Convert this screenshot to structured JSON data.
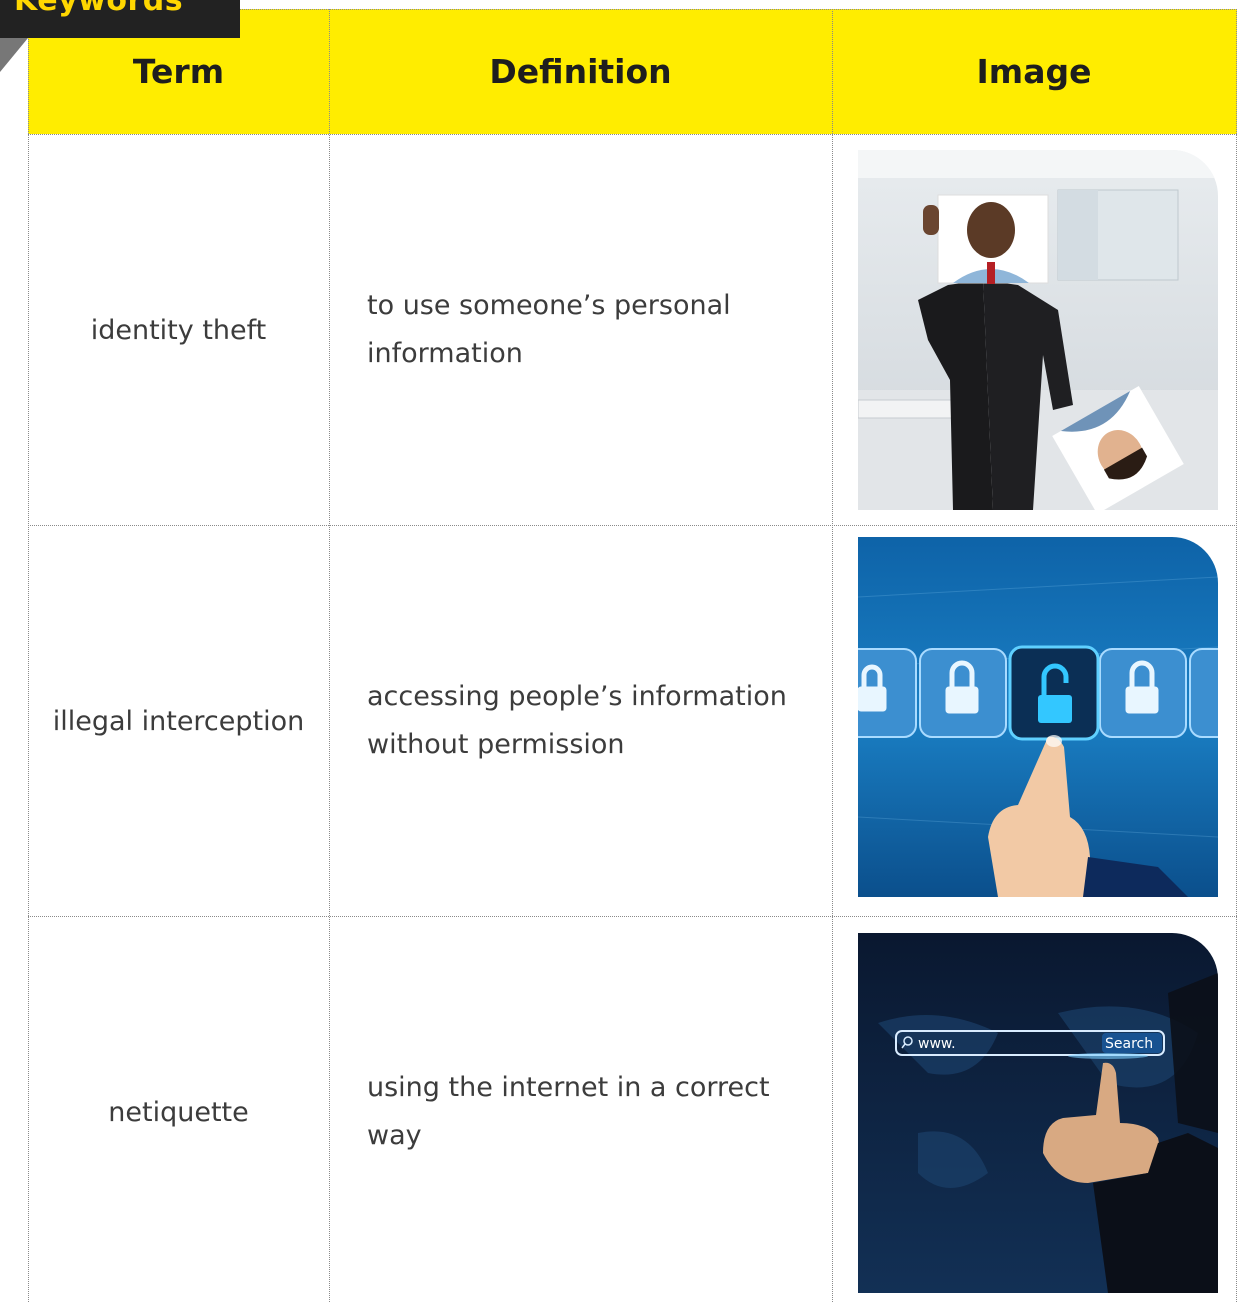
{
  "tab": {
    "label": "Keywords"
  },
  "header": {
    "term": "Term",
    "definition": "Definition",
    "image": "Image"
  },
  "rows": [
    {
      "term": "identity theft",
      "definition": "to use someone’s personal information",
      "image_icon": "businessman-holding-face-photo"
    },
    {
      "term": "illegal interception",
      "definition": "accessing people’s information without permission",
      "image_icon": "unlocked-padlock-touchscreen"
    },
    {
      "term": "netiquette",
      "definition": "using the internet in a correct way",
      "image_icon": "www-search-bar-hand",
      "search_prefix": "www.",
      "search_button": "Search"
    }
  ],
  "colors": {
    "header_yellow": "#ffed00",
    "tab_dark": "#222222",
    "tab_text": "#ffd700"
  }
}
